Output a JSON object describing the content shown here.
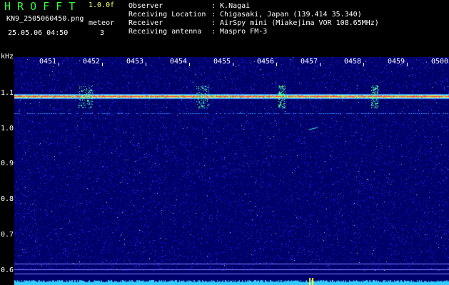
{
  "app": {
    "name": "H R O F F T",
    "version": "1.0.0f",
    "file": "KN9_2505060450.png",
    "mode": "meteor",
    "count": "3",
    "datetime": "25.05.06 04:50"
  },
  "info": {
    "observer_label": "Observer",
    "observer": ": K.Nagai",
    "location_label": "Receiving Location",
    "location": ": Chigasaki, Japan (139.414 35.340)",
    "receiver_label": "Receiver",
    "receiver": ": AirSpy mini (Miakejima VOR 108.65MHz)",
    "antenna_label": "Receiving antenna",
    "antenna": ": Maspro FM-3"
  },
  "axis": {
    "unit": "kHz",
    "y_ticks": [
      "1.1",
      "1.0",
      "0.9",
      "0.8",
      "0.7",
      "0.6"
    ],
    "x_ticks": [
      "0451",
      "0452",
      "0453",
      "0454",
      "0455",
      "0456",
      "0457",
      "0458",
      "0459",
      "0500"
    ]
  },
  "colors": {
    "background": "#00006a",
    "noise": "#3a3aff",
    "carrier": "#ff3030",
    "echo": "#33ffcc",
    "baseline": "#33ccff",
    "marker": "#ffff33"
  }
}
